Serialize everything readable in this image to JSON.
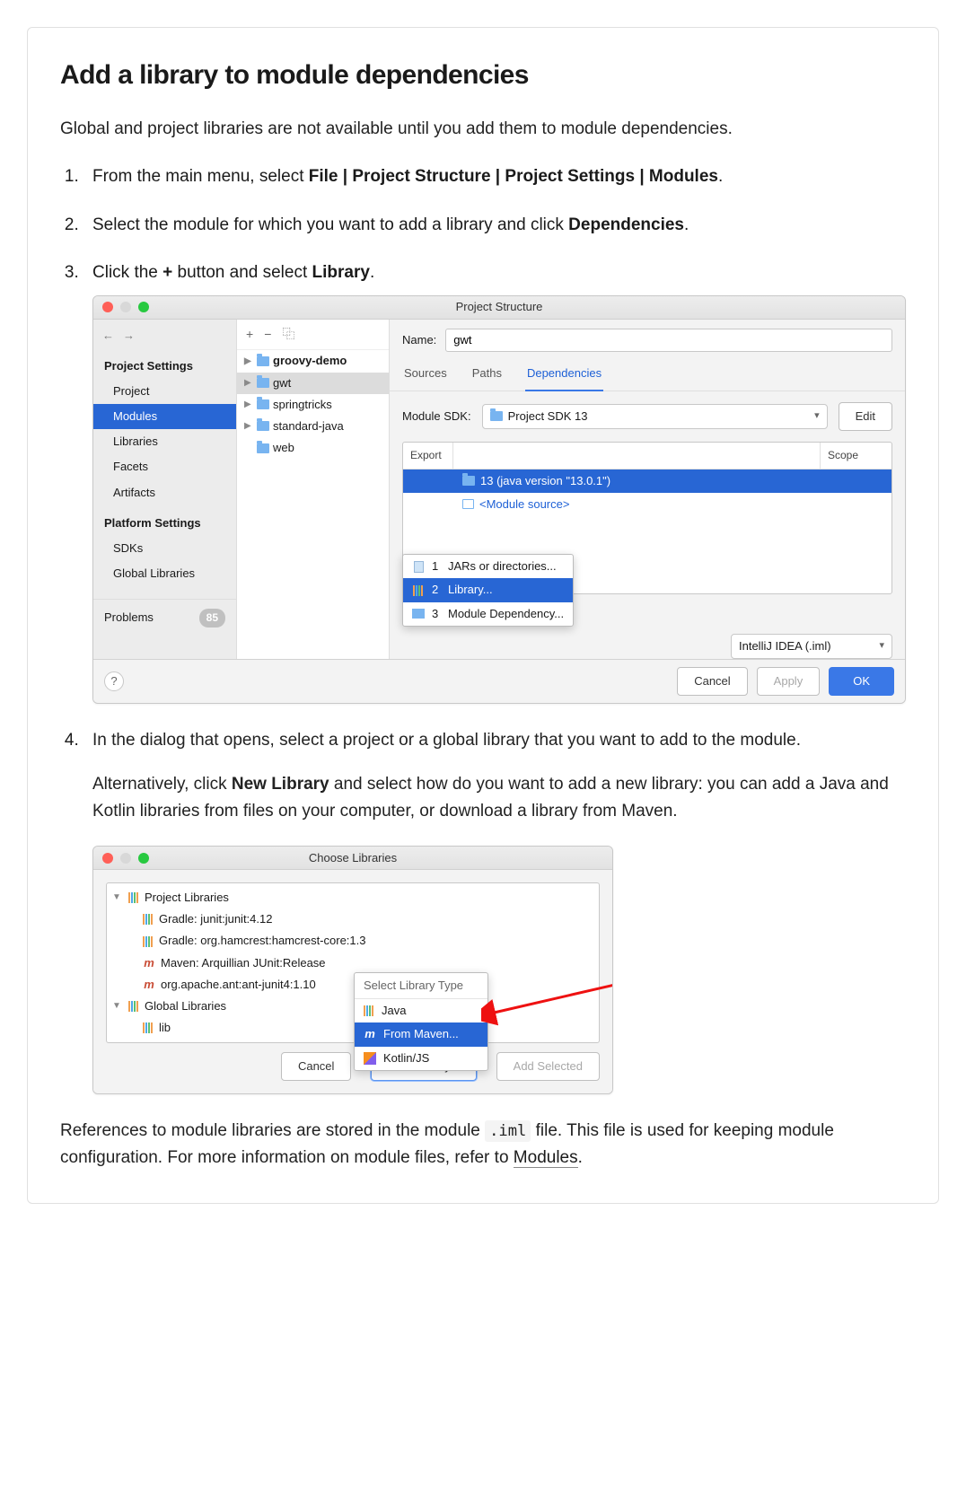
{
  "heading": "Add a library to module dependencies",
  "lead": "Global and project libraries are not available until you add them to module dependencies.",
  "steps": {
    "s1": {
      "prefix": "From the main menu, select ",
      "bold": "File | Project Structure | Project Settings | Modules",
      "suffix": "."
    },
    "s2": {
      "prefix": "Select the module for which you want to add a library and click ",
      "bold": "Dependencies",
      "suffix": "."
    },
    "s3": {
      "prefix": "Click the ",
      "icon_char": "+",
      "mid": " button and select ",
      "bold": "Library",
      "suffix": "."
    },
    "s4": {
      "line1": "In the dialog that opens, select a project or a global library that you want to add to the module.",
      "line2_a": "Alternatively, click ",
      "line2_bold": "New Library",
      "line2_b": " and select how do you want to add a new library: you can add a Java and Kotlin libraries from files on your computer, or download a library from Maven."
    }
  },
  "ps_dialog": {
    "title": "Project Structure",
    "nav": {
      "back": "←",
      "fwd": "→",
      "group1": "Project Settings",
      "items1": [
        "Project",
        "Modules",
        "Libraries",
        "Facets",
        "Artifacts"
      ],
      "group2": "Platform Settings",
      "items2": [
        "SDKs",
        "Global Libraries"
      ],
      "problems_label": "Problems",
      "problems_count": "85"
    },
    "tree": {
      "toolbar": {
        "add": "+",
        "remove": "−",
        "copy": "⿻"
      },
      "modules": [
        "groovy-demo",
        "gwt",
        "springtricks",
        "standard-java",
        "web"
      ]
    },
    "editor": {
      "name_label": "Name:",
      "name_value": "gwt",
      "tabs": [
        "Sources",
        "Paths",
        "Dependencies"
      ],
      "sdk_label": "Module SDK:",
      "sdk_value": "Project SDK 13",
      "edit_btn": "Edit",
      "cols": {
        "export": "Export",
        "scope": "Scope"
      },
      "rows": {
        "r1": "13 (java version \"13.0.1\")",
        "r2": "<Module source>"
      },
      "dep_toolbar": {
        "add": "+",
        "remove": "−",
        "up": "▲",
        "down": "▼",
        "edit": "✎"
      },
      "format_select": "IntelliJ IDEA (.iml)",
      "popup": {
        "opt1": "JARs or directories...",
        "opt2": "Library...",
        "opt3": "Module Dependency..."
      }
    },
    "buttons": {
      "help": "?",
      "cancel": "Cancel",
      "apply": "Apply",
      "ok": "OK"
    }
  },
  "cl_dialog": {
    "title": "Choose Libraries",
    "groups": {
      "project": "Project Libraries",
      "global": "Global Libraries"
    },
    "project_items": [
      "Gradle: junit:junit:4.12",
      "Gradle: org.hamcrest:hamcrest-core:1.3",
      "Maven: Arquillian JUnit:Release",
      "org.apache.ant:ant-junit4:1.10"
    ],
    "global_items": [
      "lib"
    ],
    "type_popup": {
      "title": "Select Library Type",
      "opt1": "Java",
      "opt2": "From Maven...",
      "opt3": "Kotlin/JS"
    },
    "buttons": {
      "cancel": "Cancel",
      "new_lib": "New Library...",
      "add_sel": "Add Selected"
    }
  },
  "closing": {
    "a": "References to module libraries are stored in the module ",
    "code": ".iml",
    "b": " file. This file is used for keeping module configuration. For more information on module files, refer to ",
    "link": "Modules",
    "c": "."
  }
}
